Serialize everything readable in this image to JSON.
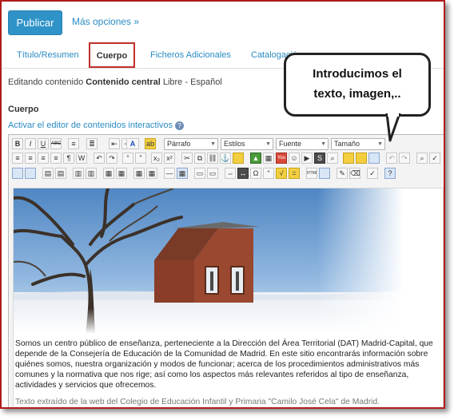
{
  "toolbar": {
    "publish_label": "Publicar",
    "more_options": "Más opciones »"
  },
  "tabs": [
    {
      "label": "Título/Resumen"
    },
    {
      "label": "Cuerpo",
      "active": true
    },
    {
      "label": "Ficheros Adicionales"
    },
    {
      "label": "Catalogación"
    }
  ],
  "editing": {
    "prefix": "Editando contenido",
    "content_name": "Contenido central",
    "language": "Libre - Español"
  },
  "section": {
    "title": "Cuerpo",
    "activate_link": "Activar el editor de contenidos interactivos"
  },
  "editor": {
    "format_select": "Párrafo",
    "style_select": "Estilos",
    "font_select": "Fuente",
    "size_select": "Tamaño"
  },
  "content": {
    "paragraph": "Somos un centro público de enseñanza, perteneciente a la Dirección del Área Territorial (DAT) Madrid-Capital, que depende de la Consejería de Educación de la Comunidad de Madrid. En este sitio encontrarás información sobre quiénes somos, nuestra organización y modos de funcionar; acerca de los procedimientos administrativos más comunes y la normativa que nos rige; así como los aspectos más relevantes referidos al tipo de enseñanza, actividades y servicios que ofrecemos.",
    "credit": "Texto extraído de la web del Colegio de Educación Infantil y Primaria \"Camilo José Cela\" de Madrid."
  },
  "callout": {
    "line1": "Introducimos el",
    "line2": "texto, imagen,.."
  },
  "colors": {
    "accent": "#2f93c8",
    "link": "#2a8bc2",
    "highlight_border": "#c0302b"
  }
}
